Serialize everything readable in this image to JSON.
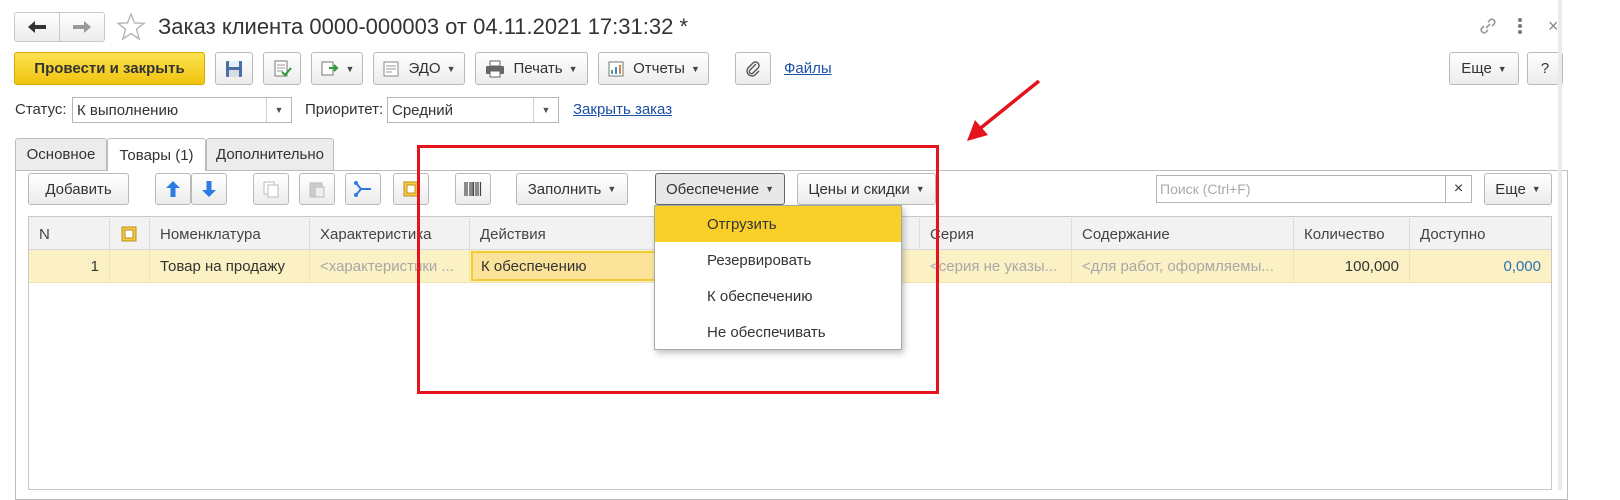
{
  "window": {
    "title": "Заказ клиента 0000-000003 от 04.11.2021 17:31:32 *"
  },
  "toolbar": {
    "post_close": "Провести и закрыть",
    "edo": "ЭДО",
    "print": "Печать",
    "reports": "Отчеты",
    "files": "Файлы",
    "more": "Еще",
    "help": "?"
  },
  "status_row": {
    "status_label": "Статус:",
    "status_value": "К выполнению",
    "priority_label": "Приоритет:",
    "priority_value": "Средний",
    "close_order": "Закрыть заказ"
  },
  "tabs": [
    {
      "label": "Основное"
    },
    {
      "label": "Товары (1)"
    },
    {
      "label": "Дополнительно"
    }
  ],
  "goods_toolbar": {
    "add": "Добавить",
    "fill": "Заполнить",
    "provision": "Обеспечение",
    "prices": "Цены и скидки",
    "search_placeholder": "Поиск (Ctrl+F)",
    "clear": "×",
    "more": "Еще"
  },
  "table": {
    "columns": [
      "N",
      "Номенклатура",
      "Характеристика",
      "Действия",
      "Серия",
      "Содержание",
      "Количество",
      "Доступно"
    ],
    "row": {
      "n": "1",
      "item": "Товар на продажу",
      "characteristic": "<характеристики ...",
      "action": "К обеспечению",
      "series": "<серия не указы...",
      "content": "<для работ, оформляемы...",
      "quantity": "100,000",
      "available": "0,000"
    }
  },
  "dropdown": {
    "items": [
      {
        "label": "Отгрузить",
        "highlighted": true
      },
      {
        "label": "Резервировать",
        "highlighted": false
      },
      {
        "label": "К обеспечению",
        "highlighted": false
      },
      {
        "label": "Не обеспечивать",
        "highlighted": false
      }
    ]
  },
  "colors": {
    "accent_yellow": "#f7d52d",
    "row_highlight": "#fbf1c4",
    "menu_highlight": "#f9cf2a",
    "annotation_red": "#e3141b",
    "link_blue": "#1a4fa3"
  }
}
